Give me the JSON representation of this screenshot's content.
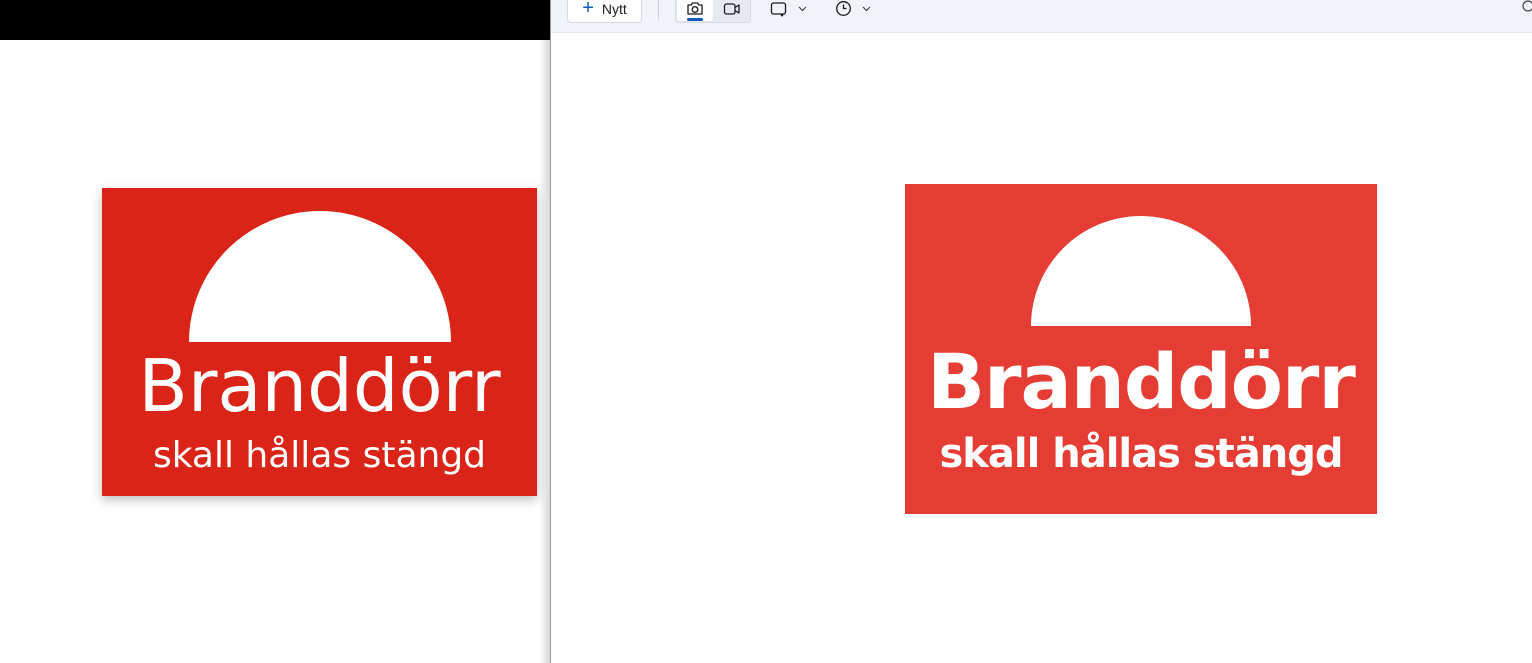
{
  "left_window": {
    "sign": {
      "title": "Branddörr",
      "subtitle": "skall hållas stängd",
      "background_color": "#da2417"
    }
  },
  "snipping_tool": {
    "toolbar": {
      "new_label": "Nytt",
      "new_icon": "plus-icon",
      "modes": [
        {
          "name": "screenshot",
          "icon": "camera-icon",
          "selected": true
        },
        {
          "name": "video",
          "icon": "video-camera-icon",
          "selected": false
        }
      ],
      "shape_icon": "rectangle-snip-icon",
      "timer_icon": "clock-icon",
      "accent_color": "#0f5cb8"
    },
    "canvas": {
      "sign": {
        "title": "Branddörr",
        "subtitle": "skall hållas stängd",
        "background_color": "#e53c34"
      }
    }
  }
}
